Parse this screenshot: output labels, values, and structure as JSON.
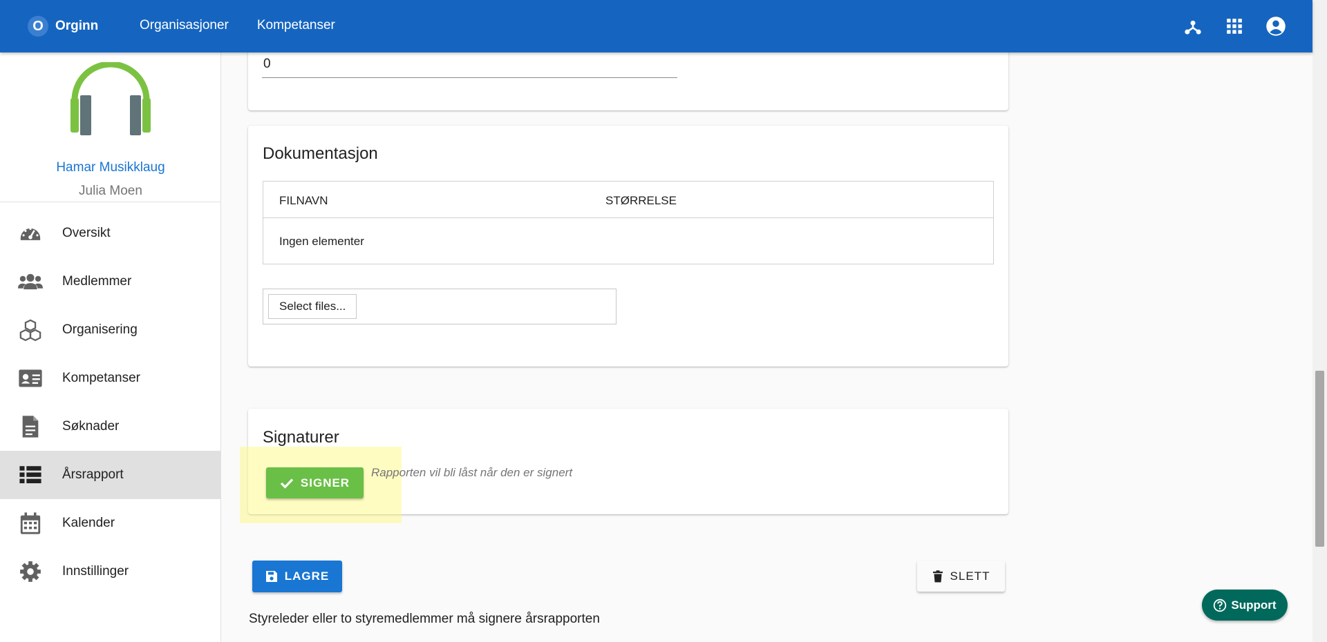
{
  "header": {
    "brand_letter": "O",
    "brand_name": "Orginn",
    "nav": [
      "Organisasjoner",
      "Kompetanser"
    ],
    "icons": [
      "hub-icon",
      "apps-grid-icon",
      "account-circle-icon"
    ]
  },
  "sidebar": {
    "org_name": "Hamar Musikklaug",
    "user_name": "Julia Moen",
    "items": [
      {
        "label": "Oversikt",
        "icon": "dashboard-gauge-icon"
      },
      {
        "label": "Medlemmer",
        "icon": "people-icon"
      },
      {
        "label": "Organisering",
        "icon": "cubes-icon"
      },
      {
        "label": "Kompetanser",
        "icon": "id-card-icon"
      },
      {
        "label": "Søknader",
        "icon": "document-icon"
      },
      {
        "label": "Årsrapport",
        "icon": "list-icon",
        "active": true
      },
      {
        "label": "Kalender",
        "icon": "calendar-icon"
      },
      {
        "label": "Innstillinger",
        "icon": "gear-icon"
      }
    ]
  },
  "main": {
    "field_value": "0",
    "documentation": {
      "title": "Dokumentasjon",
      "columns": [
        "FILNAVN",
        "STØRRELSE"
      ],
      "empty_text": "Ingen elementer",
      "select_files_label": "Select files..."
    },
    "signatures": {
      "title": "Signaturer",
      "sign_label": "SIGNER",
      "note": "Rapporten vil bli låst når den er signert"
    },
    "save_label": "LAGRE",
    "delete_label": "SLETT",
    "footer_note": "Styreleder eller to styremedlemmer må signere årsrapporten"
  },
  "support_label": "Support",
  "colors": {
    "primary": "#1565c0",
    "accent_blue": "#1976d2",
    "success": "#6abf47",
    "support": "#00695c",
    "highlight": "#fff878"
  }
}
